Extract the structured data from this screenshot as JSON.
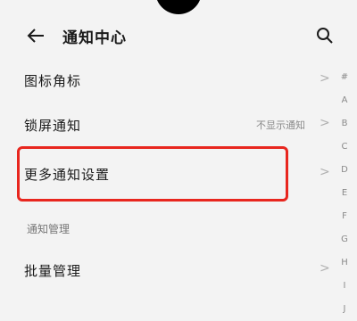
{
  "header": {
    "title": "通知中心"
  },
  "rows": [
    {
      "label": "图标角标",
      "value": ""
    },
    {
      "label": "锁屏通知",
      "value": "不显示通知"
    },
    {
      "label": "更多通知设置",
      "value": ""
    }
  ],
  "section": {
    "label": "通知管理"
  },
  "bottom_row": {
    "label": "批量管理"
  },
  "chevron_glyph": ">",
  "index_letters": [
    "#",
    "A",
    "B",
    "C",
    "D",
    "E",
    "F",
    "G",
    "H",
    "I",
    "J"
  ],
  "colors": {
    "highlight": "#e8261e",
    "background": "#f3f3f3"
  }
}
